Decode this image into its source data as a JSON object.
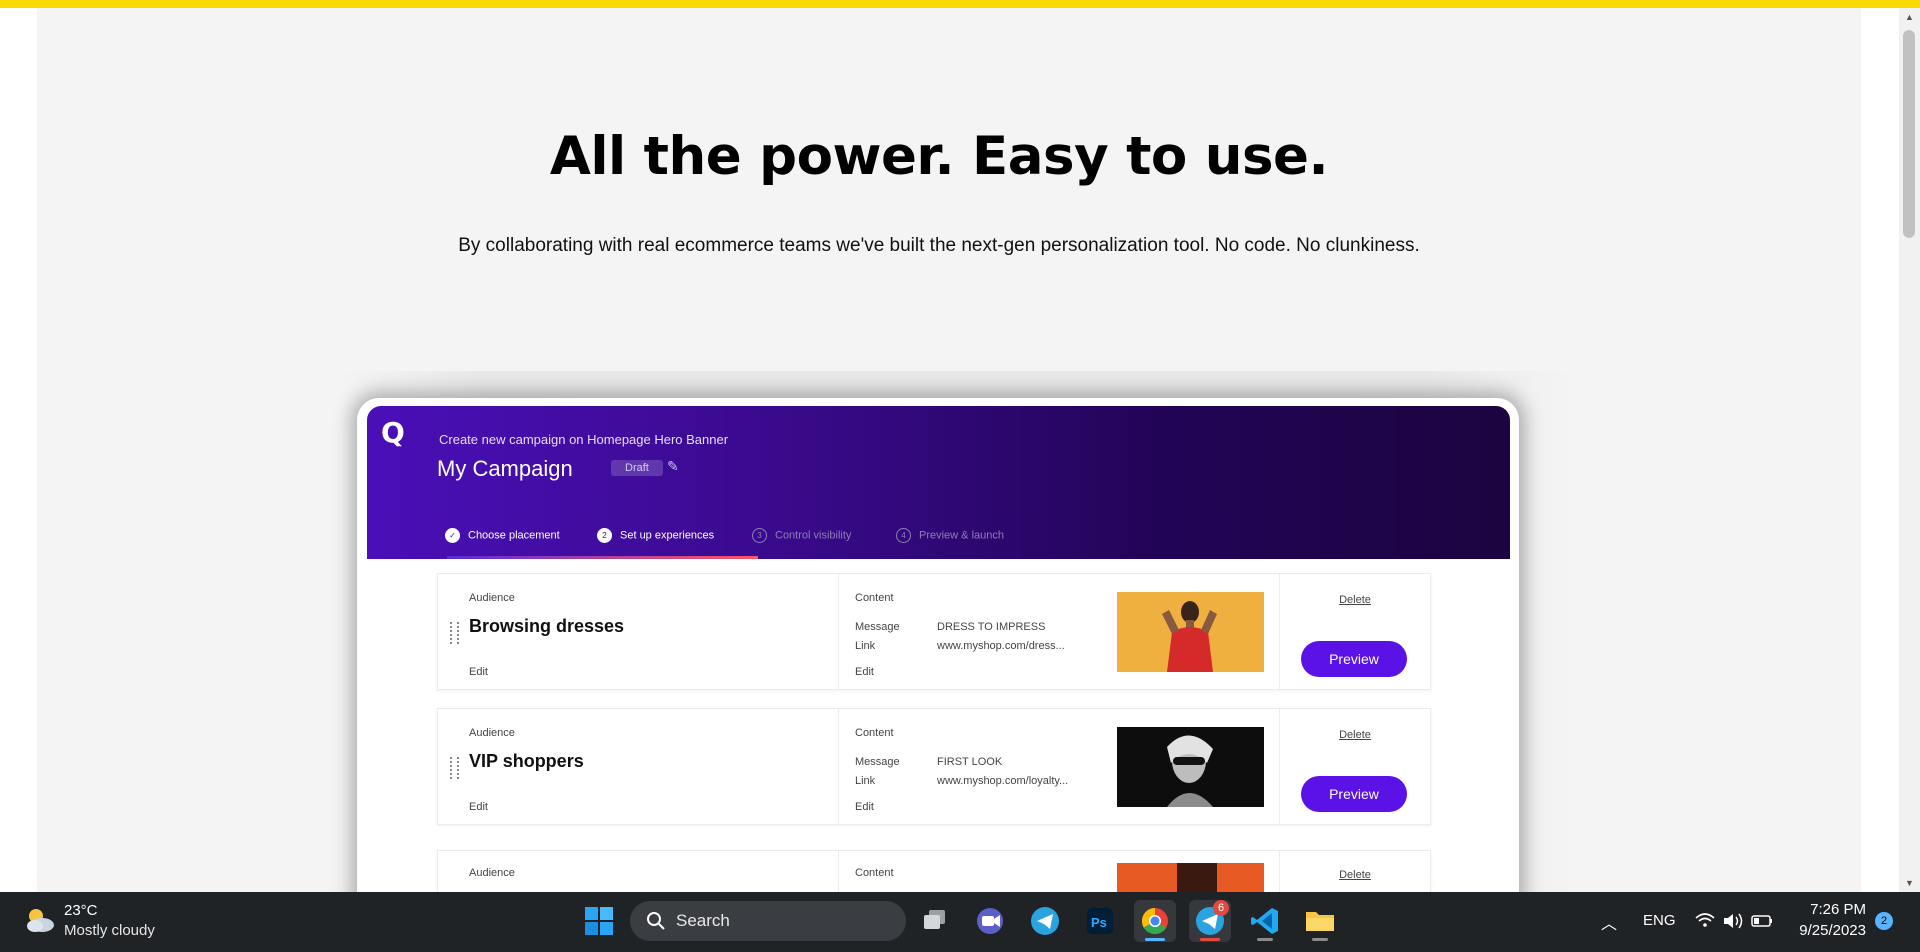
{
  "hero": {
    "title": "All the power. Easy to use.",
    "subtitle": "By collaborating with real ecommerce teams we've built the next-gen personalization tool. No code. No clunkiness."
  },
  "app": {
    "logo": "Q",
    "breadcrumb": "Create new campaign on Homepage Hero Banner",
    "campaign_name": "My Campaign",
    "status_badge": "Draft",
    "steps": [
      {
        "number": "✓",
        "label": "Choose placement"
      },
      {
        "number": "2",
        "label": "Set up experiences"
      },
      {
        "number": "3",
        "label": "Control visibility"
      },
      {
        "number": "4",
        "label": "Preview & launch"
      }
    ],
    "rows": [
      {
        "audience_label": "Audience",
        "audience": "Browsing dresses",
        "edit_label": "Edit",
        "content_label": "Content",
        "message_key": "Message",
        "message": "DRESS TO IMPRESS",
        "link_key": "Link",
        "link": "www.myshop.com/dress...",
        "content_edit": "Edit",
        "delete": "Delete",
        "preview": "Preview"
      },
      {
        "audience_label": "Audience",
        "audience": "VIP shoppers",
        "edit_label": "Edit",
        "content_label": "Content",
        "message_key": "Message",
        "message": "FIRST LOOK",
        "link_key": "Link",
        "link": "www.myshop.com/loyalty...",
        "content_edit": "Edit",
        "delete": "Delete",
        "preview": "Preview"
      },
      {
        "audience_label": "Audience",
        "content_label": "Content",
        "delete": "Delete"
      }
    ]
  },
  "taskbar": {
    "temperature": "23°C",
    "condition": "Mostly cloudy",
    "search_label": "Search",
    "telegram_badge": "6",
    "language": "ENG",
    "time": "7:26 PM",
    "date": "9/25/2023",
    "notification_count": "2"
  },
  "colors": {
    "accent_bar": "#fada00",
    "app_header_start": "#4a0fb8",
    "app_header_end": "#1c0440",
    "preview_button": "#5b12e6",
    "taskbar": "#202326"
  }
}
